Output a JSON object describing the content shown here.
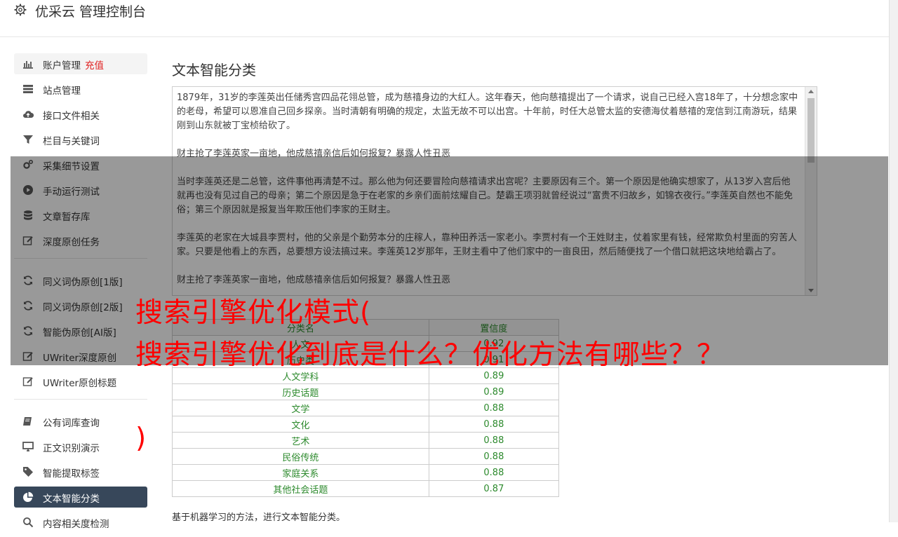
{
  "header": {
    "title": "优采云 管理控制台"
  },
  "sidebar": {
    "group1": [
      {
        "label": "账户管理",
        "extra": "充值",
        "icon": "bar-chart-icon"
      },
      {
        "label": "站点管理",
        "icon": "server-icon"
      },
      {
        "label": "接口文件相关",
        "icon": "cloud-upload-icon"
      },
      {
        "label": "栏目与关键词",
        "icon": "filter-icon"
      },
      {
        "label": "采集细节设置",
        "icon": "cogs-icon"
      },
      {
        "label": "手动运行测试",
        "icon": "play-icon"
      },
      {
        "label": "文章暂存库",
        "icon": "database-icon"
      },
      {
        "label": "深度原创任务",
        "icon": "edit-icon"
      }
    ],
    "group2": [
      {
        "label": "同义词伪原创[1版]",
        "icon": "refresh-icon"
      },
      {
        "label": "同义词伪原创[2版]",
        "icon": "refresh-icon"
      },
      {
        "label": "智能伪原创[AI版]",
        "icon": "refresh-icon"
      },
      {
        "label": "UWriter深度原创",
        "icon": "edit-icon"
      },
      {
        "label": "UWriter原创标题",
        "icon": "edit-icon"
      }
    ],
    "group3": [
      {
        "label": "公有词库查询",
        "icon": "book-icon"
      },
      {
        "label": "正文识别演示",
        "icon": "desktop-icon"
      },
      {
        "label": "智能提取标签",
        "icon": "tag-icon"
      },
      {
        "label": "文本智能分类",
        "icon": "pie-chart-icon"
      },
      {
        "label": "内容相关度检测",
        "icon": "search-icon"
      }
    ]
  },
  "main": {
    "title": "文本智能分类",
    "paragraphs": [
      "1879年，31岁的李莲英出任储秀宫四品花翎总管，成为慈禧身边的大红人。这年春天，他向慈禧提出了一个请求，说自己已经入宫18年了，十分想念家中的老母，希望可以恩准自己回乡探亲。当时清朝有明确的规定，太监无故不可以出宫。十年前，时任大总管太监的安德海仗着慈禧的宠信到江南游玩，结果刚到山东就被丁宝桢给砍了。",
      "财主抢了李莲英家一亩地，他成慈禧亲信后如何报复？暴露人性丑恶",
      "当时李莲英还是二总管，这件事他再清楚不过。那么他为何还要冒险向慈禧请求出宫呢？主要原因有三个。第一个原因是他确实想家了，从13岁入宫后他就再也没有见过自己的母亲；第二个原因是急于在老家的乡亲们面前炫耀自己。楚霸王项羽就曾经说过“富贵不归故乡，如锦衣夜行。”李莲英自然也不能免俗；第三个原因就是报复当年欺压他们李家的王财主。",
      "李莲英的老家在大城县李贾村，他的父亲是个勤劳本分的庄稼人，靠种田养活一家老小。李贾村有一个王姓财主，仗着家里有钱，经常欺负村里面的穷苦人家。只要是他看上的东西，总要想方设法搞过来。李莲英12岁那年，王财主看中了他们家中的一亩良田，然后随便找了一个借口就把这块地给霸占了。",
      "财主抢了李莲英家一亩地，他成慈禧亲信后如何报复？暴露人性丑恶"
    ],
    "table": {
      "headers": [
        "分类名",
        "置信度"
      ],
      "rows": [
        [
          "人文",
          "0.92"
        ],
        [
          "历史类",
          "0.91"
        ],
        [
          "人文学科",
          "0.89"
        ],
        [
          "历史话题",
          "0.89"
        ],
        [
          "文学",
          "0.88"
        ],
        [
          "文化",
          "0.88"
        ],
        [
          "艺术",
          "0.88"
        ],
        [
          "民俗传统",
          "0.88"
        ],
        [
          "家庭关系",
          "0.88"
        ],
        [
          "其他社会话题",
          "0.87"
        ]
      ]
    },
    "footnote": "基于机器学习的方法，进行文本智能分类。"
  },
  "overlay": {
    "line1": "搜索引擎优化模式(",
    "line2": "搜索引擎优化到底是什么？优化方法有哪些？？",
    "line3": ")"
  },
  "colors": {
    "active_bg": "#37475a",
    "table_text": "#2d8a2d",
    "overlay_text": "#ff0000",
    "recharge_text": "#e02020"
  }
}
